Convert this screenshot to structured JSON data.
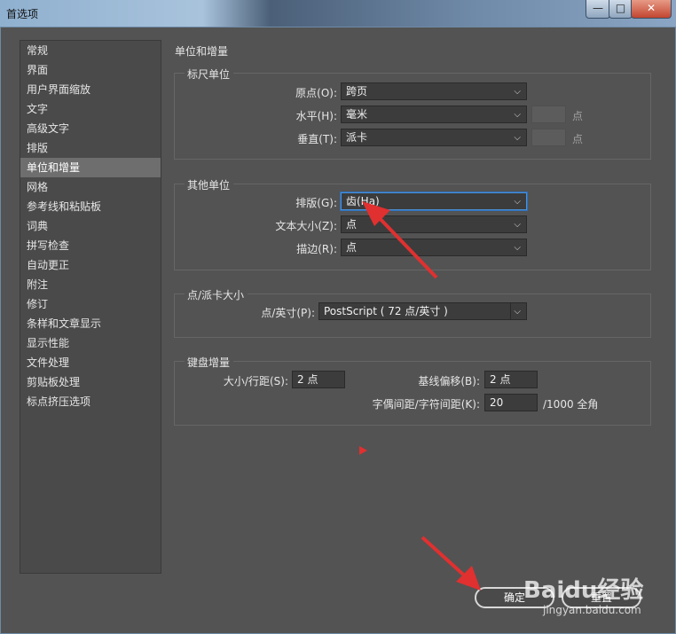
{
  "window": {
    "title": "首选项"
  },
  "titlebar": {
    "min": "—",
    "max": "□",
    "close": "✕"
  },
  "sidebar": {
    "items": [
      {
        "label": "常规"
      },
      {
        "label": "界面"
      },
      {
        "label": "用户界面缩放"
      },
      {
        "label": "文字"
      },
      {
        "label": "高级文字"
      },
      {
        "label": "排版"
      },
      {
        "label": "单位和增量",
        "selected": true
      },
      {
        "label": "网格"
      },
      {
        "label": "参考线和粘贴板"
      },
      {
        "label": "词典"
      },
      {
        "label": "拼写检查"
      },
      {
        "label": "自动更正"
      },
      {
        "label": "附注"
      },
      {
        "label": "修订"
      },
      {
        "label": "条样和文章显示"
      },
      {
        "label": "显示性能"
      },
      {
        "label": "文件处理"
      },
      {
        "label": "剪贴板处理"
      },
      {
        "label": "标点挤压选项"
      }
    ]
  },
  "main": {
    "title": "单位和增量",
    "ruler_units": {
      "legend": "标尺单位",
      "origin": {
        "label": "原点(O):",
        "value": "跨页"
      },
      "horizontal": {
        "label": "水平(H):",
        "value": "毫米",
        "unit": "点"
      },
      "vertical": {
        "label": "垂直(T):",
        "value": "派卡",
        "unit": "点"
      }
    },
    "other_units": {
      "legend": "其他单位",
      "composition": {
        "label": "排版(G):",
        "value": "齿(Ha)"
      },
      "text_size": {
        "label": "文本大小(Z):",
        "value": "点"
      },
      "stroke": {
        "label": "描边(R):",
        "value": "点"
      }
    },
    "point_pica": {
      "legend": "点/派卡大小",
      "points_inch": {
        "label": "点/英寸(P):",
        "value": "PostScript ( 72 点/英寸 )"
      }
    },
    "keyboard": {
      "legend": "键盘增量",
      "size_leading": {
        "label": "大小/行距(S):",
        "value": "2 点"
      },
      "baseline": {
        "label": "基线偏移(B):",
        "value": "2 点"
      },
      "kerning": {
        "label": "字偶间距/字符间距(K):",
        "value": "20",
        "unit": "/1000 全角"
      }
    }
  },
  "buttons": {
    "ok": "确定",
    "reset": "重置"
  },
  "watermark": {
    "brand": "Baidu经验",
    "url": "jingyan.baidu.com"
  },
  "annotation_color": "#e03030"
}
